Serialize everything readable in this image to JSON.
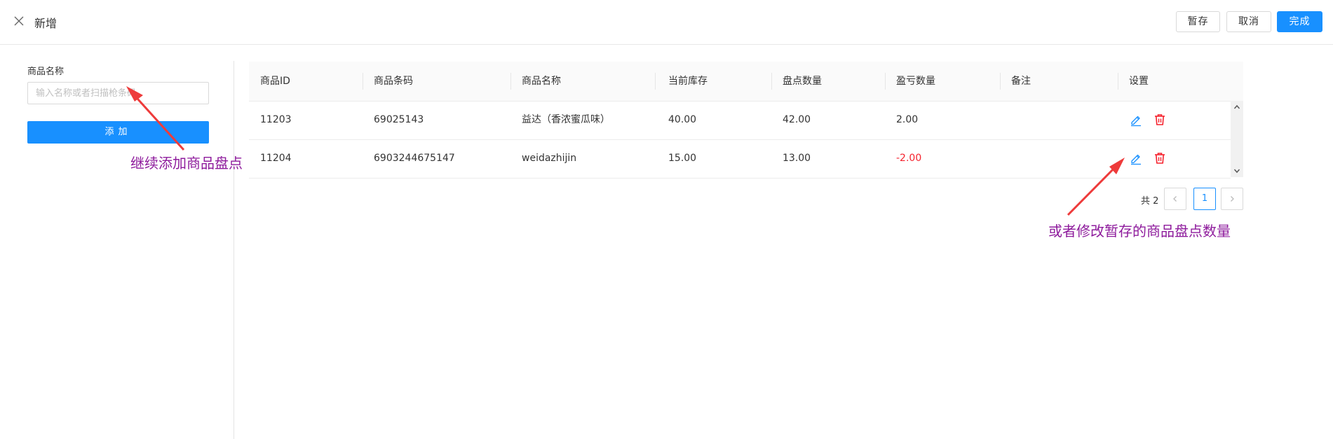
{
  "header": {
    "title": "新增",
    "save_label": "暂存",
    "cancel_label": "取消",
    "done_label": "完成"
  },
  "form": {
    "name_label": "商品名称",
    "search_placeholder": "输入名称或者扫描枪条码",
    "add_label": "添加"
  },
  "table": {
    "columns": [
      "商品ID",
      "商品条码",
      "商品名称",
      "当前库存",
      "盘点数量",
      "盈亏数量",
      "备注",
      "设置"
    ],
    "rows": [
      {
        "id": "11203",
        "barcode": "69025143",
        "name": "益达（香浓蜜瓜味）",
        "stock": "40.00",
        "count": "42.00",
        "diff": "2.00",
        "note": ""
      },
      {
        "id": "11204",
        "barcode": "6903244675147",
        "name": "weidazhijin",
        "stock": "15.00",
        "count": "13.00",
        "diff": "-2.00",
        "note": ""
      }
    ]
  },
  "pagination": {
    "total_label": "共 2",
    "current_page": "1"
  },
  "annotations": {
    "left": "继续添加商品盘点",
    "right": "或者修改暂存的商品盘点数量"
  },
  "colors": {
    "primary": "#1890ff",
    "danger": "#f5222d",
    "annotation_text": "#8e1b9c",
    "annotation_arrow": "#ee3b3b"
  },
  "icons": [
    "close-icon",
    "edit-icon",
    "delete-icon",
    "chevron-up-icon",
    "chevron-down-icon",
    "chevron-left-icon",
    "chevron-right-icon"
  ]
}
